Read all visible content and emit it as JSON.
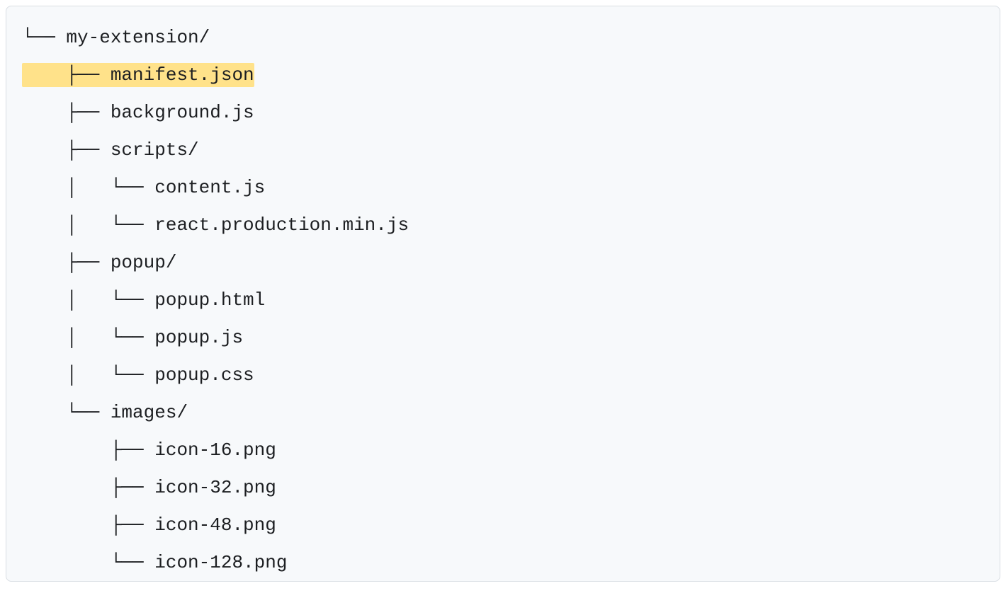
{
  "tree": {
    "lines": [
      {
        "prefix": "└── ",
        "name": "my-extension/",
        "highlight": false
      },
      {
        "prefix": "    ├── ",
        "name": "manifest.json",
        "highlight": true
      },
      {
        "prefix": "    ├── ",
        "name": "background.js",
        "highlight": false
      },
      {
        "prefix": "    ├── ",
        "name": "scripts/",
        "highlight": false
      },
      {
        "prefix": "    │   └── ",
        "name": "content.js",
        "highlight": false
      },
      {
        "prefix": "    │   └── ",
        "name": "react.production.min.js",
        "highlight": false
      },
      {
        "prefix": "    ├── ",
        "name": "popup/",
        "highlight": false
      },
      {
        "prefix": "    │   └── ",
        "name": "popup.html",
        "highlight": false
      },
      {
        "prefix": "    │   └── ",
        "name": "popup.js",
        "highlight": false
      },
      {
        "prefix": "    │   └── ",
        "name": "popup.css",
        "highlight": false
      },
      {
        "prefix": "    └── ",
        "name": "images/",
        "highlight": false
      },
      {
        "prefix": "        ├── ",
        "name": "icon-16.png",
        "highlight": false
      },
      {
        "prefix": "        ├── ",
        "name": "icon-32.png",
        "highlight": false
      },
      {
        "prefix": "        ├── ",
        "name": "icon-48.png",
        "highlight": false
      },
      {
        "prefix": "        └── ",
        "name": "icon-128.png",
        "highlight": false
      }
    ]
  }
}
